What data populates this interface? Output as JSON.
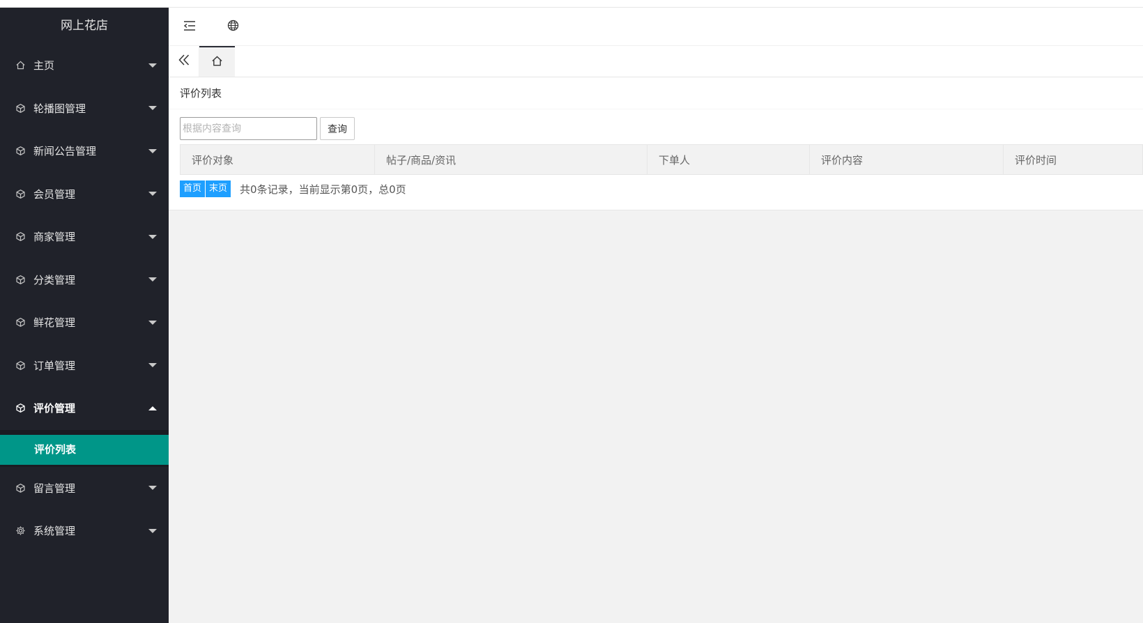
{
  "app": {
    "title": "网上花店"
  },
  "sidebar": {
    "items": [
      {
        "label": "主页",
        "icon": "home-icon"
      },
      {
        "label": "轮播图管理",
        "icon": "cube-icon"
      },
      {
        "label": "新闻公告管理",
        "icon": "cube-icon"
      },
      {
        "label": "会员管理",
        "icon": "cube-icon"
      },
      {
        "label": "商家管理",
        "icon": "cube-icon"
      },
      {
        "label": "分类管理",
        "icon": "cube-icon"
      },
      {
        "label": "鲜花管理",
        "icon": "cube-icon"
      },
      {
        "label": "订单管理",
        "icon": "cube-icon"
      },
      {
        "label": "评价管理",
        "icon": "cube-icon",
        "expanded": true,
        "children": [
          {
            "label": "评价列表",
            "active": true
          }
        ]
      },
      {
        "label": "留言管理",
        "icon": "cube-icon"
      },
      {
        "label": "系统管理",
        "icon": "gear-icon"
      }
    ]
  },
  "header": {
    "menu_toggle_icon": "indent-icon",
    "globe_icon": "globe-icon"
  },
  "tabs": {
    "back_icon": "double-chevron-left-icon",
    "home_icon": "home-icon"
  },
  "main": {
    "card_title": "评价列表",
    "search": {
      "placeholder": "根据内容查询",
      "value": "",
      "button_label": "查询"
    },
    "table": {
      "columns": [
        "评价对象",
        "帖子/商品/资讯",
        "下单人",
        "评价内容",
        "评价时间"
      ],
      "rows": []
    },
    "pager": {
      "first_label": "首页",
      "last_label": "末页",
      "info": "共0条记录，当前显示第0页，总0页"
    }
  },
  "colors": {
    "sidebar_bg": "#20222a",
    "active_item": "#009688",
    "pager_btn": "#1e9fff"
  }
}
